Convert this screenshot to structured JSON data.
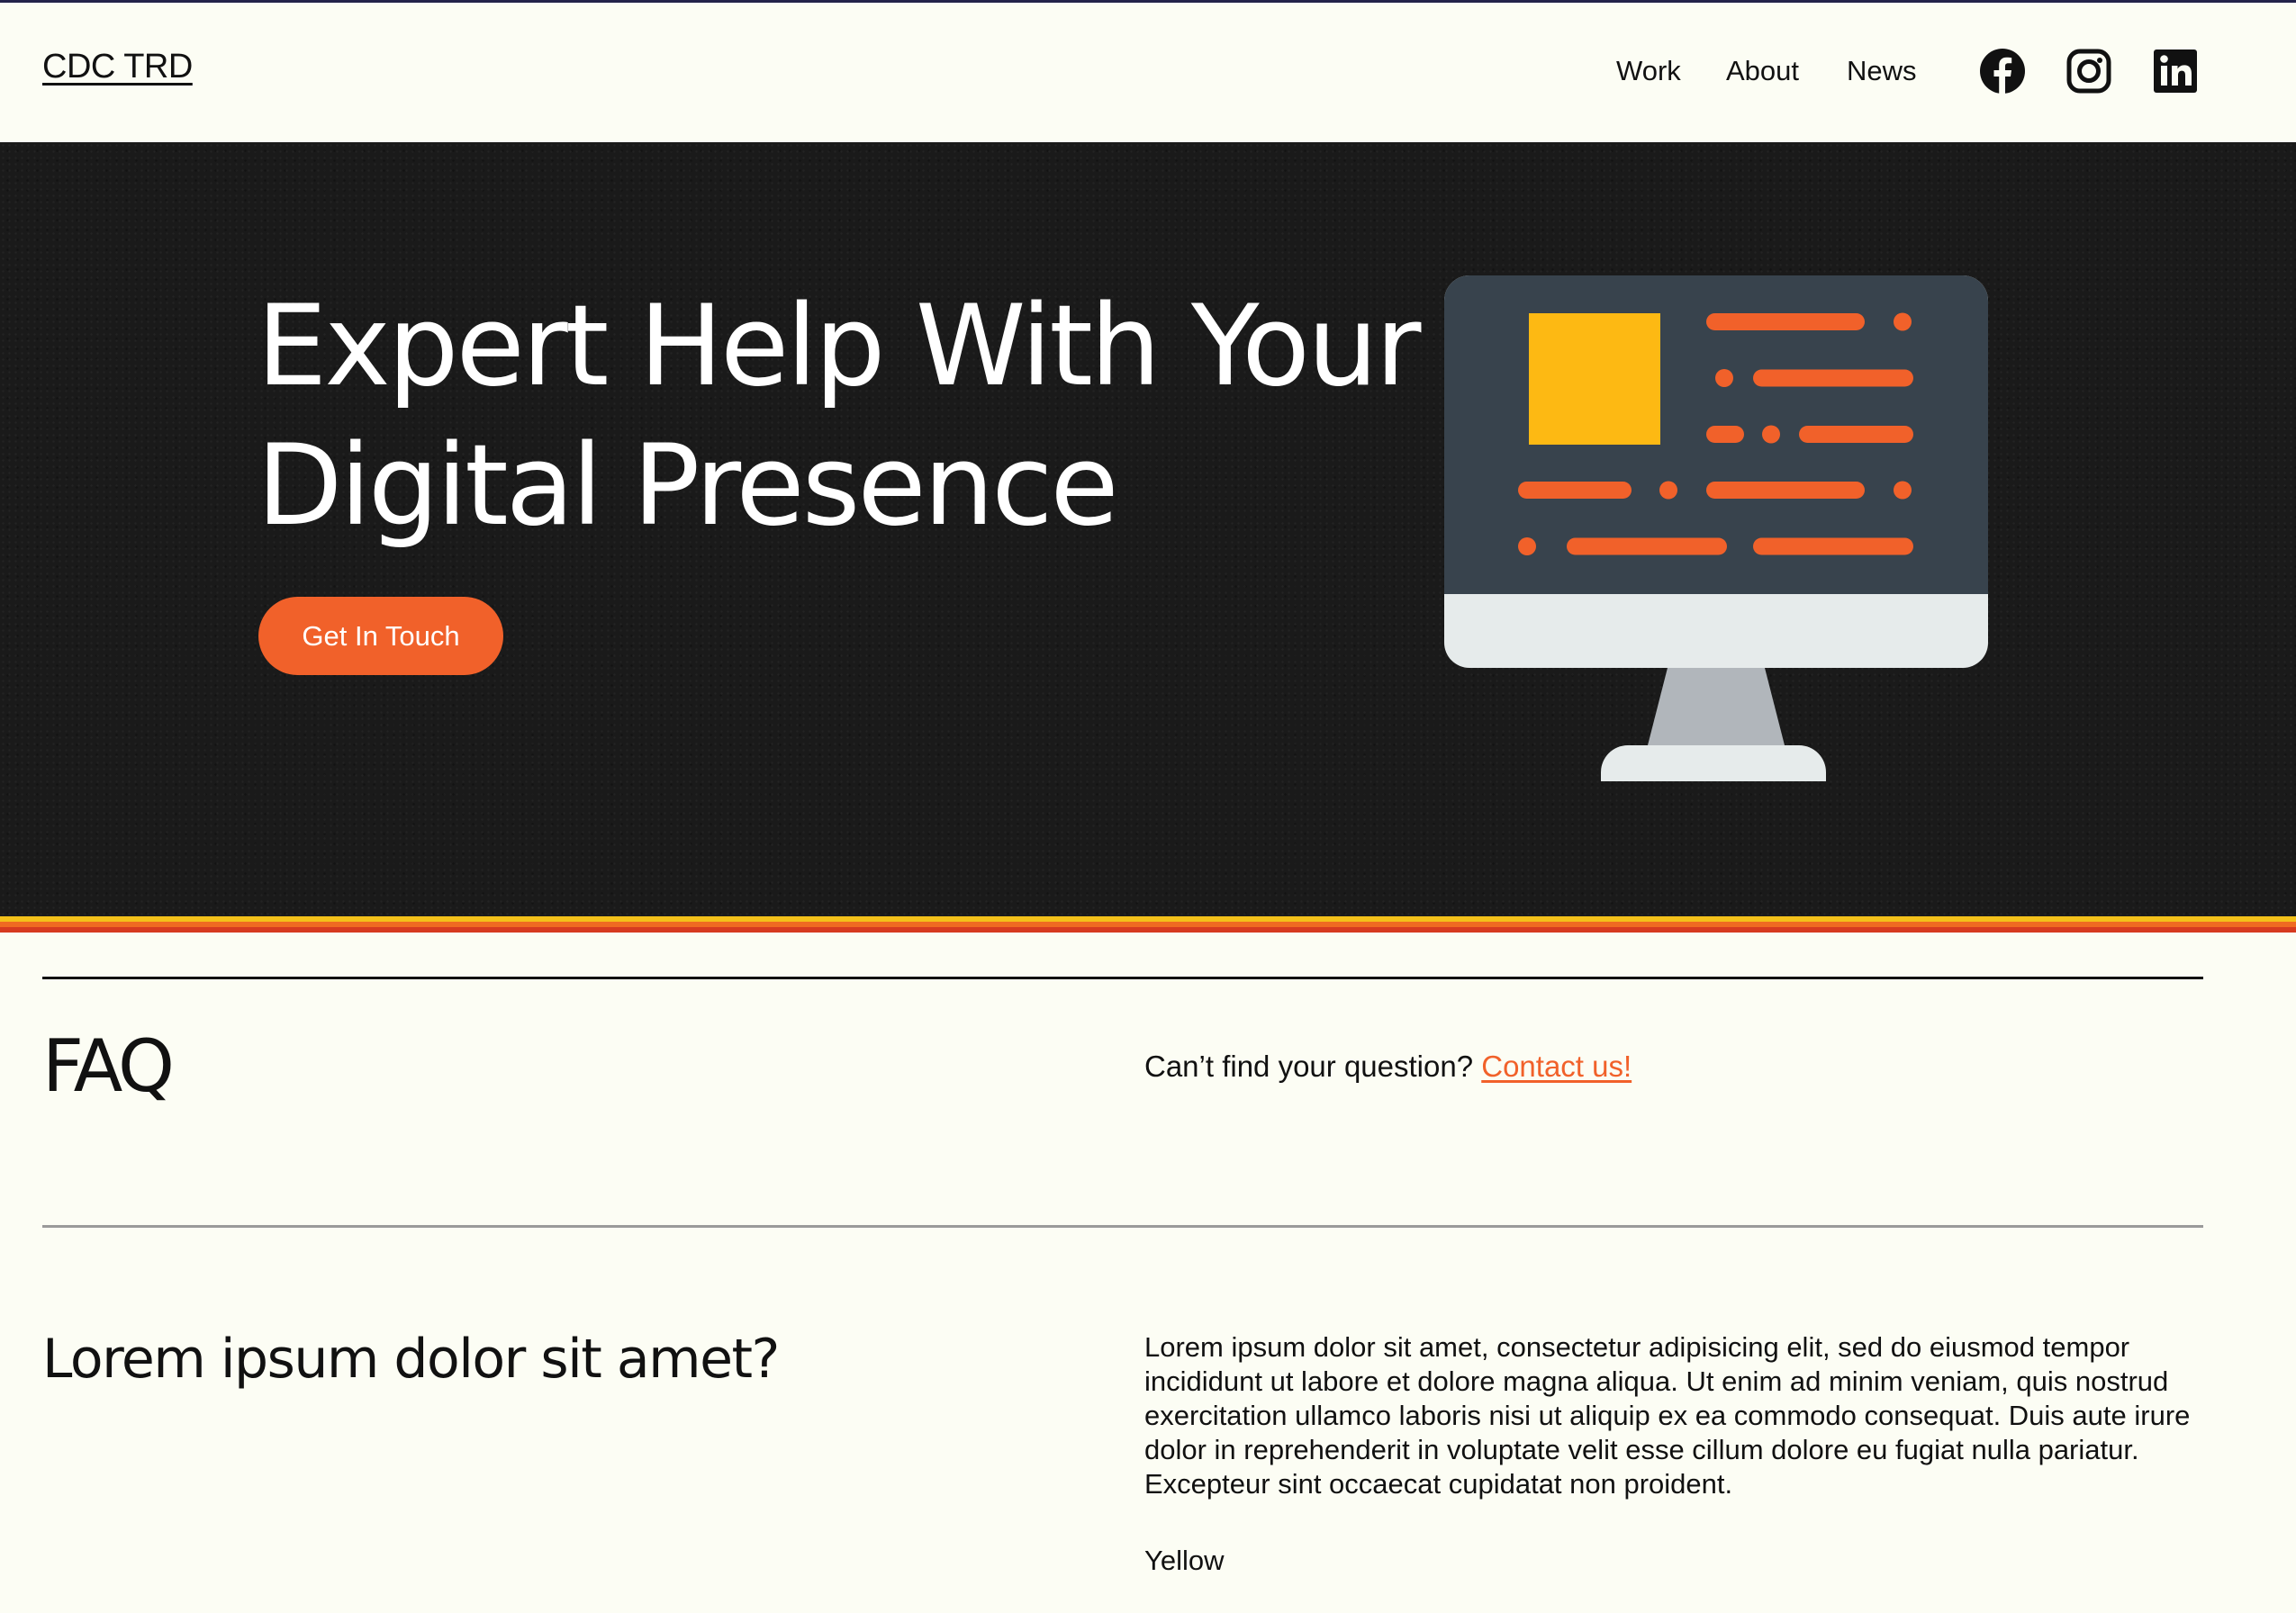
{
  "header": {
    "logo": "CDC TRD",
    "nav": [
      "Work",
      "About",
      "News"
    ],
    "social": [
      "facebook-icon",
      "instagram-icon",
      "linkedin-icon"
    ]
  },
  "hero": {
    "title": "Expert Help With Your Digital Presence",
    "cta": "Get In Touch",
    "illustration": "desktop-computer-icon"
  },
  "faq": {
    "heading": "FAQ",
    "prompt": "Can’t find your question?",
    "contact_link": "Contact us!",
    "items": [
      {
        "question": "Lorem ipsum dolor sit amet?",
        "answer": "Lorem ipsum dolor sit amet, consectetur adipisicing elit, sed do eiusmod tempor incididunt ut labore et dolore magna aliqua. Ut enim ad minim veniam, quis nostrud exercitation ullamco laboris nisi ut aliquip ex ea commodo consequat. Duis aute irure dolor in reprehenderit in voluptate velit esse cillum dolore eu fugiat nulla pariatur. Excepteur sint occaecat cupidatat non proident.",
        "answer_extra": "Yellow"
      }
    ]
  },
  "colors": {
    "accent": "#f1612a",
    "background": "#fcfdf4",
    "hero_bg": "#1a1a1a",
    "yellow": "#fdb913"
  }
}
